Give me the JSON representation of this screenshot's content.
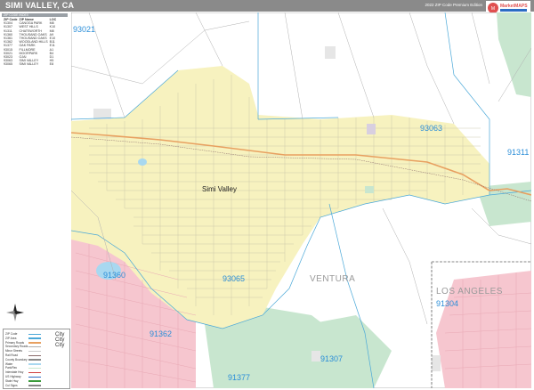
{
  "header": {
    "title": "SIMI VALLEY, CA",
    "edition": "2022 ZIP Code Premium Edition",
    "logo": "MarketMAPS"
  },
  "zip_table": {
    "section_label": "ZIP CODE INDEX",
    "columns": [
      "ZIP Code",
      "ZIP Name",
      "LOC"
    ],
    "rows": [
      [
        "91304",
        "CANOGA PARK",
        "M8"
      ],
      [
        "91307",
        "WEST HILLS",
        "K10"
      ],
      [
        "91311",
        "CHATSWORTH",
        "M8"
      ],
      [
        "91360",
        "THOUSAND OAKS",
        "A9"
      ],
      [
        "91361",
        "THOUSAND OAKS",
        "E10"
      ],
      [
        "91362",
        "WOODLAND HILLS",
        "B11"
      ],
      [
        "91377",
        "OAK PARK",
        "E11"
      ],
      [
        "93015",
        "FILLMORE",
        "A1"
      ],
      [
        "93021",
        "MOORPARK",
        "B4"
      ],
      [
        "93023",
        "OJAI",
        "D1"
      ],
      [
        "93063",
        "SIMI VALLEY",
        "H5"
      ],
      [
        "93065",
        "SIMI VALLEY",
        "E8"
      ]
    ]
  },
  "map": {
    "city_label": "Simi Valley",
    "county_labels": [
      "VENTURA",
      "LOS ANGELES"
    ],
    "zip_labels": [
      "93021",
      "93063",
      "91311",
      "91360",
      "93065",
      "91304",
      "91362",
      "91307",
      "91377"
    ],
    "colors": {
      "city": "#f7f2bf",
      "residential_grid": "#c9c4a8",
      "park": "#c8e6cf",
      "pink_zone": "#f6c6cf",
      "water": "#a8d8f0",
      "freeway": "#e8a060",
      "zip_boundary": "#4aa8d8",
      "county_boundary": "#8a8a8a",
      "label": "#2b8ed8"
    }
  },
  "legend": {
    "items": [
      "ZIP Code",
      "ZIP Area",
      "Primary Roads",
      "Secondary Roads",
      "Minor Streets",
      "Rail Road",
      "County Boundary",
      "Water",
      "Park/Rec",
      "Interstate Hwy",
      "US Highway",
      "State Hwy",
      "Cul Signs"
    ],
    "city_labels": [
      "City",
      "City",
      "City"
    ]
  },
  "compass": {
    "north": "N"
  }
}
